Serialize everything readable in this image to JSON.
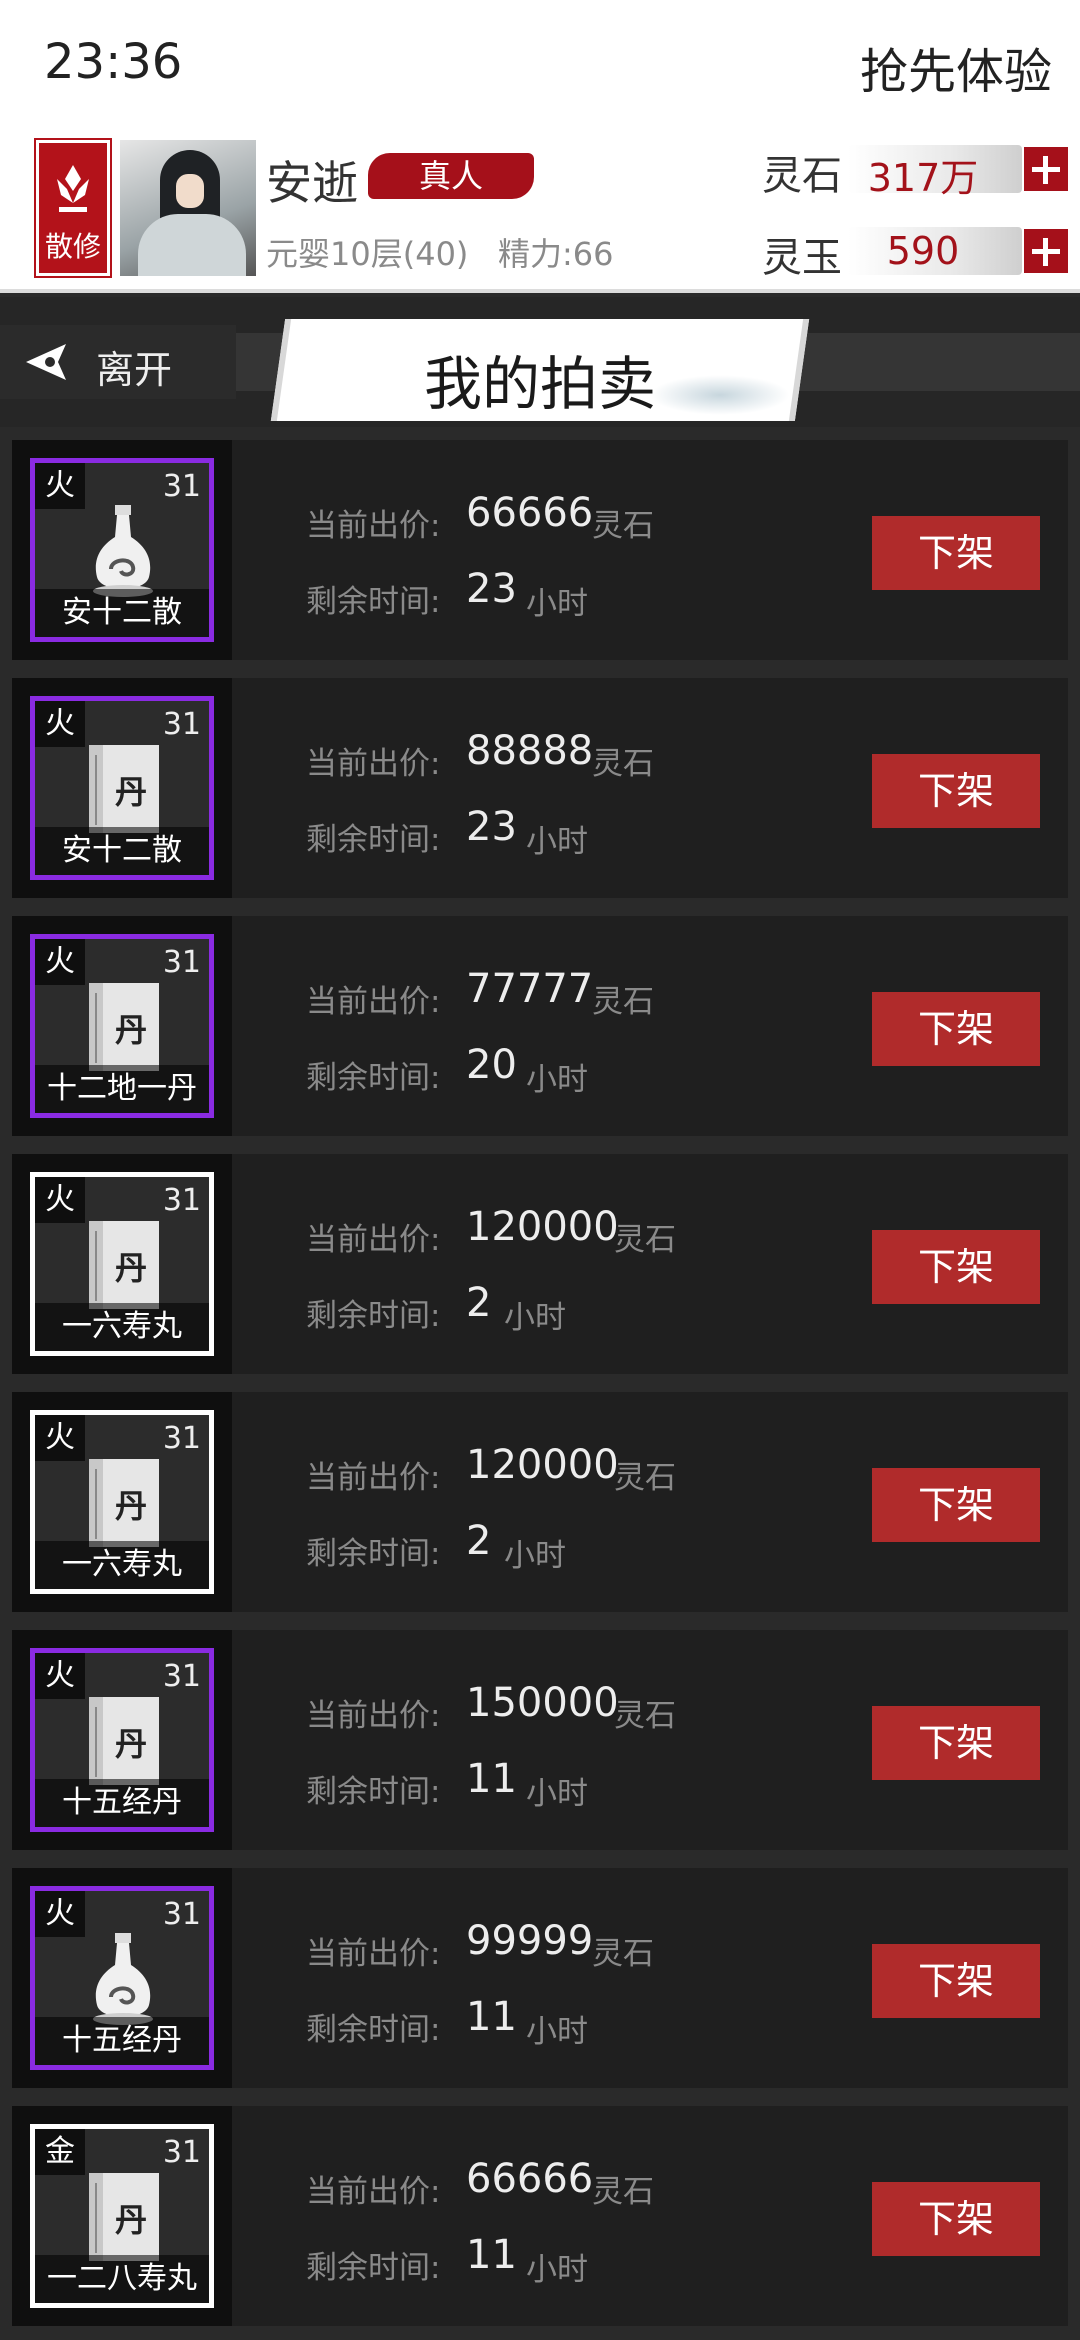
{
  "status": {
    "time": "23:36",
    "early_access": "抢先体验"
  },
  "player": {
    "sect": "散修",
    "name": "安逝",
    "tag": "真人",
    "realm": "元婴10层(40)",
    "energy": "精力:66",
    "currencies": [
      {
        "label": "灵石",
        "value": "317万"
      },
      {
        "label": "灵玉",
        "value": "590"
      }
    ]
  },
  "nav": {
    "back_label": "离开",
    "title": "我的拍卖"
  },
  "labels": {
    "price": "当前出价:",
    "time": "剩余时间:",
    "unit_currency": "灵石",
    "unit_time": "小时",
    "delist": "下架"
  },
  "items": [
    {
      "element": "火",
      "level": "31",
      "name": "安十二散",
      "icon": "vase-icon",
      "rarity": "purple",
      "price": "66666",
      "hours": "23"
    },
    {
      "element": "火",
      "level": "31",
      "name": "安十二散",
      "icon": "pill-book-icon",
      "rarity": "purple",
      "price": "88888",
      "hours": "23"
    },
    {
      "element": "火",
      "level": "31",
      "name": "十二地一丹",
      "icon": "pill-book-icon",
      "rarity": "purple",
      "price": "77777",
      "hours": "20"
    },
    {
      "element": "火",
      "level": "31",
      "name": "一六寿丸",
      "icon": "pill-book-icon",
      "rarity": "white",
      "price": "120000",
      "hours": "2"
    },
    {
      "element": "火",
      "level": "31",
      "name": "一六寿丸",
      "icon": "pill-book-icon",
      "rarity": "white",
      "price": "120000",
      "hours": "2"
    },
    {
      "element": "火",
      "level": "31",
      "name": "十五经丹",
      "icon": "pill-book-icon",
      "rarity": "purple",
      "price": "150000",
      "hours": "11"
    },
    {
      "element": "火",
      "level": "31",
      "name": "十五经丹",
      "icon": "vase-icon",
      "rarity": "purple",
      "price": "99999",
      "hours": "11"
    },
    {
      "element": "金",
      "level": "31",
      "name": "一二八寿丸",
      "icon": "pill-book-icon",
      "rarity": "white",
      "price": "66666",
      "hours": "11"
    }
  ],
  "colors": {
    "accent_red": "#b02b2b",
    "rarity_purple": "#8a2be2",
    "rarity_white": "#ffffff"
  }
}
